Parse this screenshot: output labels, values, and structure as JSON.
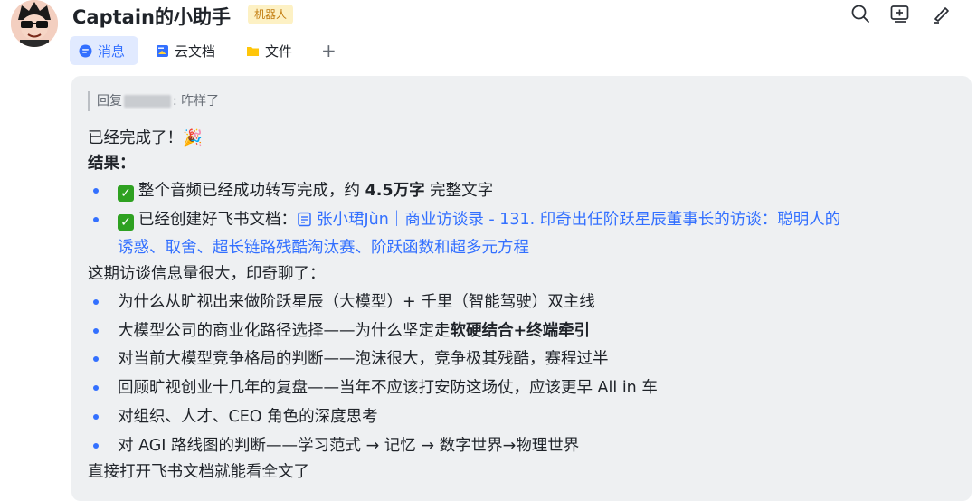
{
  "header": {
    "title": "Captain的小助手",
    "badge": "机器人",
    "tabs": [
      {
        "label": "消息",
        "icon": "message-icon",
        "active": true
      },
      {
        "label": "云文档",
        "icon": "cloud-doc-icon",
        "active": false
      },
      {
        "label": "文件",
        "icon": "folder-icon",
        "active": false
      }
    ],
    "add_tab_label": "+",
    "actions": [
      "search-icon",
      "add-chat-icon",
      "edit-icon"
    ]
  },
  "message": {
    "quote_prefix": "回复",
    "quote_suffix": ": 咋样了",
    "line1": "已经完成了！🎉",
    "result_label": "结果：",
    "item1_pre": "整个音频已经成功转写完成，约 ",
    "item1_bold": "4.5万字",
    "item1_post": " 完整文字",
    "item2_pre": "已经创建好飞书文档：",
    "doc_title_line1": "张小珺Jùn｜商业访谈录 - 131. 印奇出任阶跃星辰董事长的访谈：聪明人的",
    "doc_title_line2": "诱惑、取舍、超长链路残酷淘汰赛、阶跃函数和超多元方程",
    "intro": "这期访谈信息量很大，印奇聊了：",
    "topic1": "为什么从旷视出来做阶跃星辰（大模型）+ 千里（智能驾驶）双主线",
    "topic2_pre": "大模型公司的商业化路径选择——为什么坚定走",
    "topic2_bold": "软硬结合+终端牵引",
    "topic3": "对当前大模型竞争格局的判断——泡沫很大，竞争极其残酷，赛程过半",
    "topic4": "回顾旷视创业十几年的复盘——当年不应该打安防这场仗，应该更早 All in 车",
    "topic5": "对组织、人才、CEO 角色的深度思考",
    "topic6": "对 AGI 路线图的判断——学习范式 → 记忆 → 数字世界→物理世界",
    "closing": "直接打开飞书文档就能看全文了"
  },
  "colors": {
    "accent": "#3370ff",
    "badge_bg": "#fdf1c4",
    "badge_text": "#c27c0e",
    "bubble_bg": "#eef0f2",
    "check_green": "#2ea121"
  }
}
